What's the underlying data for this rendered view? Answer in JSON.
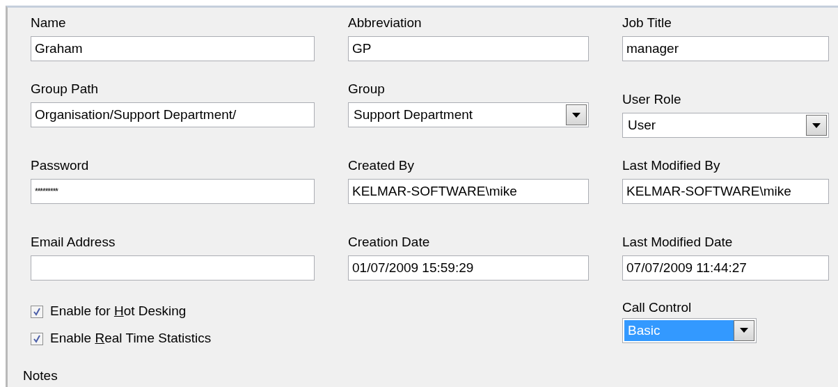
{
  "rows": [
    [
      {
        "label": "Name",
        "kind": "text",
        "value": "Graham"
      },
      {
        "label": "Abbreviation",
        "kind": "text",
        "value": "GP"
      },
      {
        "label": "Job Title",
        "kind": "text",
        "value": "manager"
      }
    ],
    [
      {
        "label": "Group Path",
        "kind": "text",
        "value": "Organisation/Support Department/"
      },
      {
        "label": "Group",
        "kind": "select",
        "value": "Support Department"
      },
      {
        "label": "User Role",
        "kind": "select",
        "value": "User"
      }
    ],
    [
      {
        "label": "Password",
        "kind": "password",
        "value": "*********"
      },
      {
        "label": "Created By",
        "kind": "text",
        "value": "KELMAR-SOFTWARE\\mike"
      },
      {
        "label": "Last Modified By",
        "kind": "text",
        "value": "KELMAR-SOFTWARE\\mike"
      }
    ],
    [
      {
        "label": "Email Address",
        "kind": "text"
      },
      {
        "label": "Creation Date",
        "kind": "text",
        "value": "01/07/2009 15:59:29"
      },
      {
        "label": "Last Modified Date",
        "kind": "text",
        "value": "07/07/2009 11:44:27"
      }
    ]
  ],
  "checkboxes": [
    {
      "before": "Enable for ",
      "key": "H",
      "after": "ot Desking",
      "checked": true
    },
    {
      "before": "Enable ",
      "key": "R",
      "after": "eal Time Statistics",
      "checked": true
    }
  ],
  "call_control": {
    "label": "Call Control",
    "value": "Basic",
    "selected": true
  },
  "notes_label": "Notes"
}
